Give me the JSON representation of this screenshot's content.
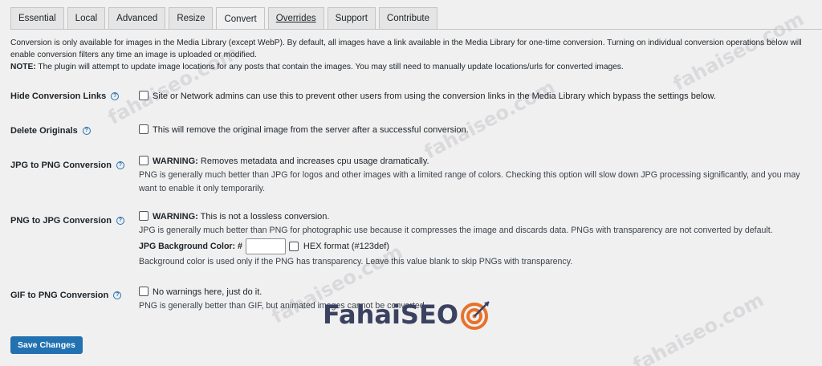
{
  "tabs": [
    "Essential",
    "Local",
    "Advanced",
    "Resize",
    "Convert",
    "Overrides",
    "Support",
    "Contribute"
  ],
  "intro": {
    "line1": "Conversion is only available for images in the Media Library (except WebP). By default, all images have a link available in the Media Library for one-time conversion. Turning on individual conversion operations below will enable conversion filters any time an image is uploaded or modified.",
    "note_label": "NOTE:",
    "note_text": " The plugin will attempt to update image locations for any posts that contain the images. You may still need to manually update locations/urls for converted images."
  },
  "settings": {
    "hide_links": {
      "label": "Hide Conversion Links",
      "text": "Site or Network admins can use this to prevent other users from using the conversion links in the Media Library which bypass the settings below."
    },
    "delete_originals": {
      "label": "Delete Originals",
      "text": "This will remove the original image from the server after a successful conversion."
    },
    "jpg_to_png": {
      "label": "JPG to PNG Conversion",
      "warn": "WARNING:",
      "text": " Removes metadata and increases cpu usage dramatically.",
      "desc": "PNG is generally much better than JPG for logos and other images with a limited range of colors. Checking this option will slow down JPG processing significantly, and you may want to enable it only temporarily."
    },
    "png_to_jpg": {
      "label": "PNG to JPG Conversion",
      "warn": "WARNING:",
      "text": " This is not a lossless conversion.",
      "desc": "JPG is generally much better than PNG for photographic use because it compresses the image and discards data. PNGs with transparency are not converted by default.",
      "bg_label": "JPG Background Color: #",
      "bg_value": "",
      "hex_hint": "HEX format (#123def)",
      "bg_desc": "Background color is used only if the PNG has transparency. Leave this value blank to skip PNGs with transparency."
    },
    "gif_to_png": {
      "label": "GIF to PNG Conversion",
      "text": "No warnings here, just do it.",
      "desc": "PNG is generally better than GIF, but animated images cannot be converted."
    }
  },
  "help_glyph": "?",
  "save_label": "Save Changes",
  "watermark": "fahaiseo.com",
  "logo": {
    "part1": "Fahai",
    "part2": "SEO"
  },
  "colors": {
    "accent": "#2271b1",
    "logo_orange": "#e8722a",
    "logo_navy": "#3b4160"
  }
}
